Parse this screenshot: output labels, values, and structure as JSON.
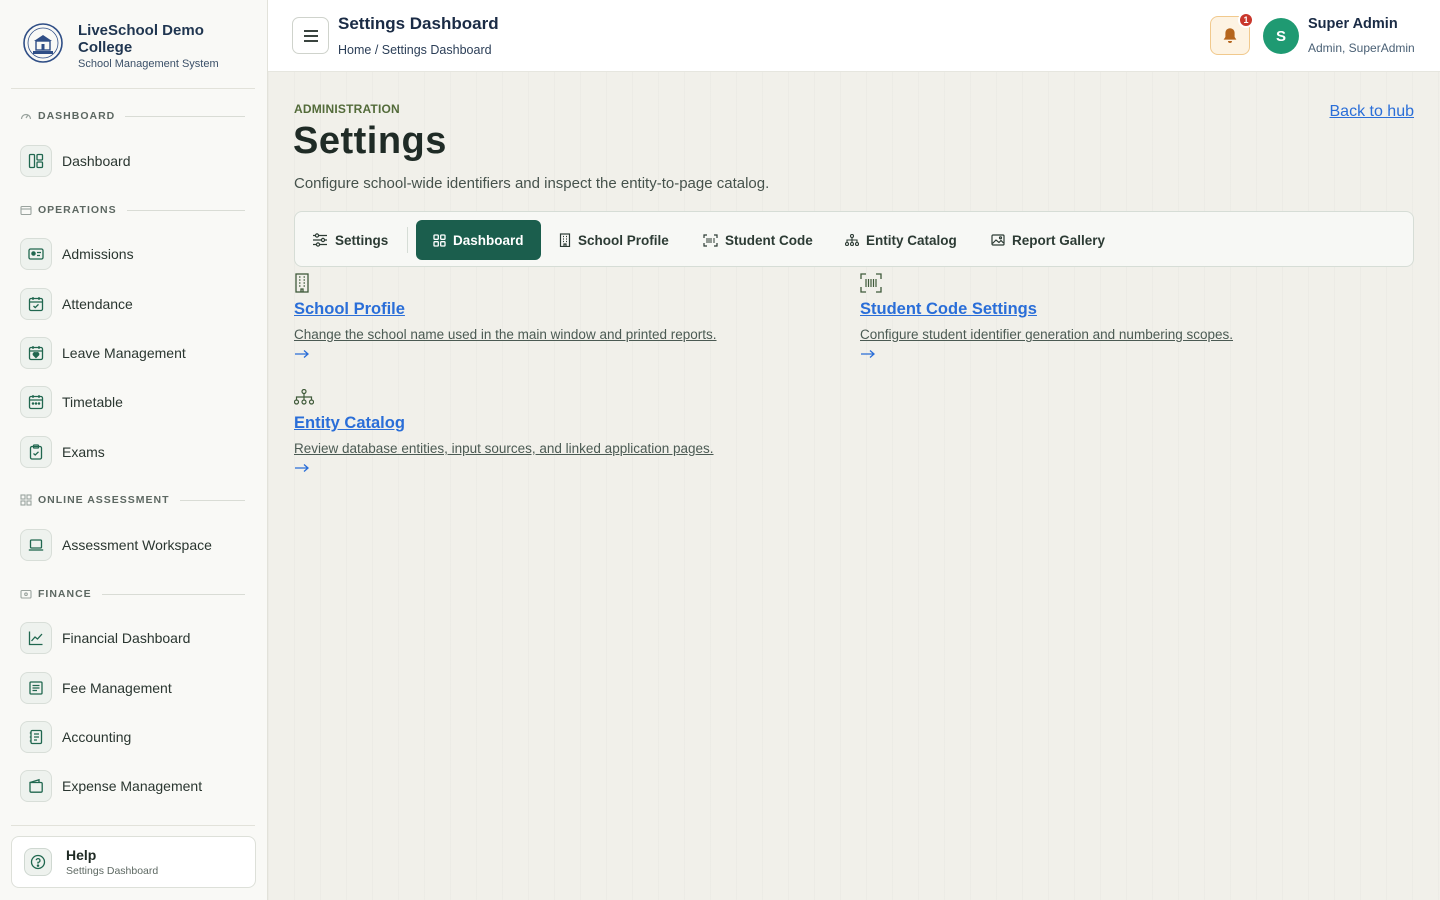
{
  "brand": {
    "name": "LiveSchool Demo College",
    "subtitle": "School Management System"
  },
  "sidebar": {
    "sections": [
      {
        "label": "DASHBOARD",
        "icon": "gauge-icon"
      },
      {
        "label": "OPERATIONS",
        "icon": "folder-icon"
      },
      {
        "label": "ONLINE ASSESSMENT",
        "icon": "grid-icon"
      },
      {
        "label": "FINANCE",
        "icon": "wallet-icon"
      }
    ],
    "items": [
      {
        "label": "Dashboard",
        "icon": "layout-icon"
      },
      {
        "label": "Admissions",
        "icon": "id-card-icon"
      },
      {
        "label": "Attendance",
        "icon": "calendar-check-icon"
      },
      {
        "label": "Leave Management",
        "icon": "calendar-heart-icon"
      },
      {
        "label": "Timetable",
        "icon": "calendar-icon"
      },
      {
        "label": "Exams",
        "icon": "clipboard-check-icon"
      },
      {
        "label": "Assessment Workspace",
        "icon": "laptop-icon"
      },
      {
        "label": "Financial Dashboard",
        "icon": "chart-line-icon"
      },
      {
        "label": "Fee Management",
        "icon": "receipt-icon"
      },
      {
        "label": "Accounting",
        "icon": "ledger-icon"
      },
      {
        "label": "Expense Management",
        "icon": "wallet-icon"
      }
    ],
    "help": {
      "title": "Help",
      "subtitle": "Settings Dashboard"
    }
  },
  "header": {
    "title": "Settings Dashboard",
    "breadcrumb": "Home / Settings Dashboard",
    "notification_count": "1",
    "user": {
      "initial": "S",
      "name": "Super Admin",
      "role": "Admin, SuperAdmin"
    }
  },
  "main": {
    "eyebrow": "ADMINISTRATION",
    "title": "Settings",
    "description": "Configure school-wide identifiers and inspect the entity-to-page catalog.",
    "back_link": "Back to hub",
    "tabs": [
      {
        "label": "Settings",
        "icon": "sliders-icon"
      },
      {
        "label": "Dashboard",
        "icon": "grid-icon",
        "active": true
      },
      {
        "label": "School Profile",
        "icon": "building-icon"
      },
      {
        "label": "Student Code",
        "icon": "barcode-icon"
      },
      {
        "label": "Entity Catalog",
        "icon": "sitemap-icon"
      },
      {
        "label": "Report Gallery",
        "icon": "image-icon"
      }
    ],
    "cards": [
      {
        "title": "School Profile",
        "description": "Change the school name used in the main window and printed reports.",
        "icon": "building-icon"
      },
      {
        "title": "Student Code Settings",
        "description": "Configure student identifier generation and numbering scopes.",
        "icon": "barcode-icon"
      },
      {
        "title": "Entity Catalog",
        "description": "Review database entities, input sources, and linked application pages.",
        "icon": "sitemap-icon"
      }
    ]
  },
  "colors": {
    "primary": "#1b5e4d",
    "link": "#2a6ed8",
    "avatar": "#1f9a72",
    "badge": "#c9372c",
    "bell_bg": "#fdf3e3"
  }
}
